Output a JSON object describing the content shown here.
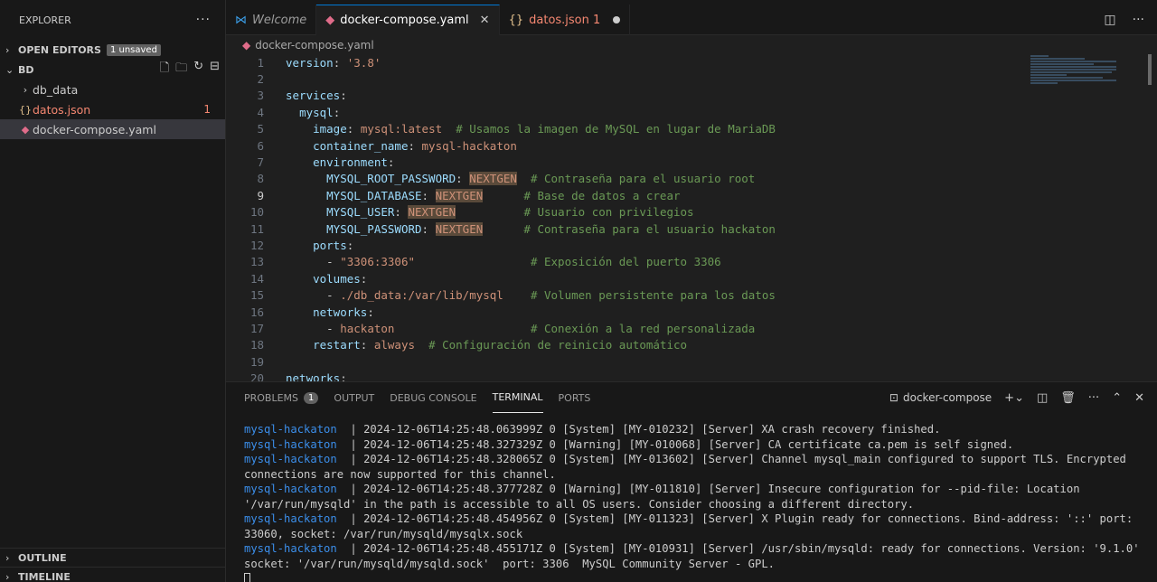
{
  "sidebar": {
    "title": "EXPLORER",
    "more": "···",
    "open_editors": "OPEN EDITORS",
    "unsaved_badge": "1 unsaved",
    "folder": "BD",
    "items": [
      {
        "label": "db_data",
        "icon": ">"
      },
      {
        "label": "datos.json",
        "icon": "{}",
        "count": "1"
      },
      {
        "label": "docker-compose.yaml",
        "icon": "docker-icon"
      }
    ],
    "outline": "OUTLINE",
    "timeline": "TIMELINE"
  },
  "tabs": [
    {
      "label": "Welcome",
      "icon": "vscode-icon"
    },
    {
      "label": "docker-compose.yaml",
      "icon": "docker-icon",
      "close": "✕"
    },
    {
      "label": "datos.json 1",
      "icon": "{}"
    }
  ],
  "breadcrumb": "docker-compose.yaml",
  "editor": {
    "current_line": 9,
    "lines": [
      {
        "n": "1",
        "t": [
          [
            "k",
            "version"
          ],
          [
            "p",
            ": "
          ],
          [
            "s",
            "'3.8'"
          ]
        ]
      },
      {
        "n": "2",
        "t": []
      },
      {
        "n": "3",
        "t": [
          [
            "k",
            "services"
          ],
          [
            "p",
            ":"
          ]
        ]
      },
      {
        "n": "4",
        "t": [
          [
            "p",
            "  "
          ],
          [
            "k",
            "mysql"
          ],
          [
            "p",
            ":"
          ]
        ]
      },
      {
        "n": "5",
        "t": [
          [
            "p",
            "    "
          ],
          [
            "k",
            "image"
          ],
          [
            "p",
            ": "
          ],
          [
            "s",
            "mysql:latest"
          ],
          [
            "p",
            "  "
          ],
          [
            "c",
            "# Usamos la imagen de MySQL en lugar de MariaDB"
          ]
        ]
      },
      {
        "n": "6",
        "t": [
          [
            "p",
            "    "
          ],
          [
            "k",
            "container_name"
          ],
          [
            "p",
            ": "
          ],
          [
            "s",
            "mysql-hackaton"
          ]
        ]
      },
      {
        "n": "7",
        "t": [
          [
            "p",
            "    "
          ],
          [
            "k",
            "environment"
          ],
          [
            "p",
            ":"
          ]
        ]
      },
      {
        "n": "8",
        "t": [
          [
            "p",
            "      "
          ],
          [
            "k",
            "MYSQL_ROOT_PASSWORD"
          ],
          [
            "p",
            ": "
          ],
          [
            "hs",
            "NEXTGEN"
          ],
          [
            "p",
            "  "
          ],
          [
            "c",
            "# Contraseña para el usuario root"
          ]
        ]
      },
      {
        "n": "9",
        "t": [
          [
            "p",
            "      "
          ],
          [
            "k",
            "MYSQL_DATABASE"
          ],
          [
            "p",
            ": "
          ],
          [
            "hs",
            "NEXTGEN"
          ],
          [
            "p",
            "      "
          ],
          [
            "c",
            "# Base de datos a crear"
          ]
        ]
      },
      {
        "n": "10",
        "t": [
          [
            "p",
            "      "
          ],
          [
            "k",
            "MYSQL_USER"
          ],
          [
            "p",
            ": "
          ],
          [
            "hs",
            "NEXTGEN"
          ],
          [
            "p",
            "          "
          ],
          [
            "c",
            "# Usuario con privilegios"
          ]
        ]
      },
      {
        "n": "11",
        "t": [
          [
            "p",
            "      "
          ],
          [
            "k",
            "MYSQL_PASSWORD"
          ],
          [
            "p",
            ": "
          ],
          [
            "hs",
            "NEXTGEN"
          ],
          [
            "p",
            "      "
          ],
          [
            "c",
            "# Contraseña para el usuario hackaton"
          ]
        ]
      },
      {
        "n": "12",
        "t": [
          [
            "p",
            "    "
          ],
          [
            "k",
            "ports"
          ],
          [
            "p",
            ":"
          ]
        ]
      },
      {
        "n": "13",
        "t": [
          [
            "p",
            "      - "
          ],
          [
            "s",
            "\"3306:3306\""
          ],
          [
            "p",
            "                 "
          ],
          [
            "c",
            "# Exposición del puerto 3306"
          ]
        ]
      },
      {
        "n": "14",
        "t": [
          [
            "p",
            "    "
          ],
          [
            "k",
            "volumes"
          ],
          [
            "p",
            ":"
          ]
        ]
      },
      {
        "n": "15",
        "t": [
          [
            "p",
            "      - "
          ],
          [
            "s",
            "./db_data:/var/lib/mysql"
          ],
          [
            "p",
            "    "
          ],
          [
            "c",
            "# Volumen persistente para los datos"
          ]
        ]
      },
      {
        "n": "16",
        "t": [
          [
            "p",
            "    "
          ],
          [
            "k",
            "networks"
          ],
          [
            "p",
            ":"
          ]
        ]
      },
      {
        "n": "17",
        "t": [
          [
            "p",
            "      - "
          ],
          [
            "s",
            "hackaton"
          ],
          [
            "p",
            "                    "
          ],
          [
            "c",
            "# Conexión a la red personalizada"
          ]
        ]
      },
      {
        "n": "18",
        "t": [
          [
            "p",
            "    "
          ],
          [
            "k",
            "restart"
          ],
          [
            "p",
            ": "
          ],
          [
            "s",
            "always"
          ],
          [
            "p",
            "  "
          ],
          [
            "c",
            "# Configuración de reinicio automático"
          ]
        ]
      },
      {
        "n": "19",
        "t": []
      },
      {
        "n": "20",
        "t": [
          [
            "k",
            "networks"
          ],
          [
            "p",
            ":"
          ]
        ]
      }
    ]
  },
  "panel": {
    "tabs": [
      {
        "label": "PROBLEMS",
        "badge": "1"
      },
      {
        "label": "OUTPUT"
      },
      {
        "label": "DEBUG CONSOLE"
      },
      {
        "label": "TERMINAL",
        "active": true
      },
      {
        "label": "PORTS"
      }
    ],
    "terminal_name": "docker-compose",
    "log": [
      {
        "svc": "mysql-hackaton  ",
        "msg": "| 2024-12-06T14:25:48.063999Z 0 [System] [MY-010232] [Server] XA crash recovery finished."
      },
      {
        "svc": "mysql-hackaton  ",
        "msg": "| 2024-12-06T14:25:48.327329Z 0 [Warning] [MY-010068] [Server] CA certificate ca.pem is self signed."
      },
      {
        "svc": "mysql-hackaton  ",
        "msg": "| 2024-12-06T14:25:48.328065Z 0 [System] [MY-013602] [Server] Channel mysql_main configured to support TLS. Encrypted connections are now supported for this channel."
      },
      {
        "svc": "mysql-hackaton  ",
        "msg": "| 2024-12-06T14:25:48.377728Z 0 [Warning] [MY-011810] [Server] Insecure configuration for --pid-file: Location '/var/run/mysqld' in the path is accessible to all OS users. Consider choosing a different directory."
      },
      {
        "svc": "mysql-hackaton  ",
        "msg": "| 2024-12-06T14:25:48.454956Z 0 [System] [MY-011323] [Server] X Plugin ready for connections. Bind-address: '::' port: 33060, socket: /var/run/mysqld/mysqlx.sock"
      },
      {
        "svc": "mysql-hackaton  ",
        "msg": "| 2024-12-06T14:25:48.455171Z 0 [System] [MY-010931] [Server] /usr/sbin/mysqld: ready for connections. Version: '9.1.0'  socket: '/var/run/mysqld/mysqld.sock'  port: 3306  MySQL Community Server - GPL."
      }
    ]
  }
}
